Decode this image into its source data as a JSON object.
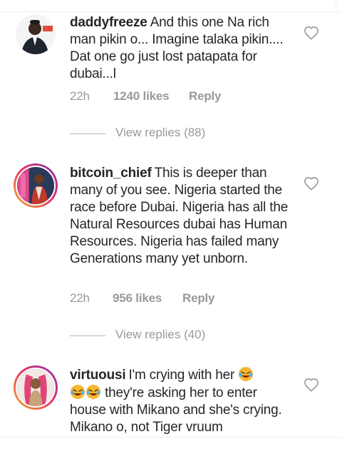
{
  "comments": [
    {
      "username": "daddyfreeze",
      "text": "And this one Na rich man pikin o... Imagine talaka pikin.... Dat one go just lost patapata for dubai...l",
      "time": "22h",
      "likes": "1240 likes",
      "reply": "Reply",
      "view_replies": "View replies (88)"
    },
    {
      "username": "bitcoin_chief",
      "text": "This is deeper than many of you see. Nigeria started the race before Dubai. Nigeria has all the Natural Resources dubai has Human Resources. Nigeria has failed many Generations many yet unborn.",
      "time": "22h",
      "likes": "956 likes",
      "reply": "Reply",
      "view_replies": "View replies (40)"
    },
    {
      "username": "virtuousi",
      "text_part1": "I'm crying with her",
      "text_part2": "they're asking her to enter house with Mikano and she's crying. Mikano o, not Tiger vruum"
    }
  ],
  "colors": {
    "text": "#262626",
    "muted": "#999999",
    "ring_start": "#f9b233",
    "ring_mid": "#e1306c",
    "ring_end": "#833ab4"
  },
  "icons": {
    "like": "heart-outline-icon",
    "emoji": "crying-laughing-emoji"
  }
}
